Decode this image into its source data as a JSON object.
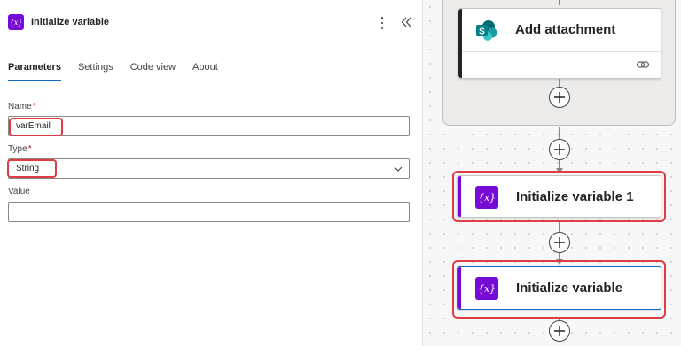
{
  "panel": {
    "title": "Initialize variable",
    "icon": "variable-icon",
    "tabs": [
      {
        "label": "Parameters",
        "active": true
      },
      {
        "label": "Settings",
        "active": false
      },
      {
        "label": "Code view",
        "active": false
      },
      {
        "label": "About",
        "active": false
      }
    ],
    "fields": {
      "name": {
        "label": "Name",
        "required": "*",
        "value": "varEmail"
      },
      "type": {
        "label": "Type",
        "required": "*",
        "value": "String"
      },
      "value": {
        "label": "Value",
        "value": ""
      }
    }
  },
  "canvas": {
    "cards": [
      {
        "title": "Add attachment",
        "icon": "sharepoint-icon"
      },
      {
        "title": "Initialize variable 1",
        "icon": "variable-icon",
        "icon_text": "{x}"
      },
      {
        "title": "Initialize variable",
        "icon": "variable-icon",
        "icon_text": "{x}"
      }
    ]
  },
  "colors": {
    "accent": "#0f6cbd",
    "variable_purple": "#770bd6",
    "highlight_red": "#e03c44",
    "sharepoint_teal": "#038387"
  },
  "icon_text": "{x}"
}
